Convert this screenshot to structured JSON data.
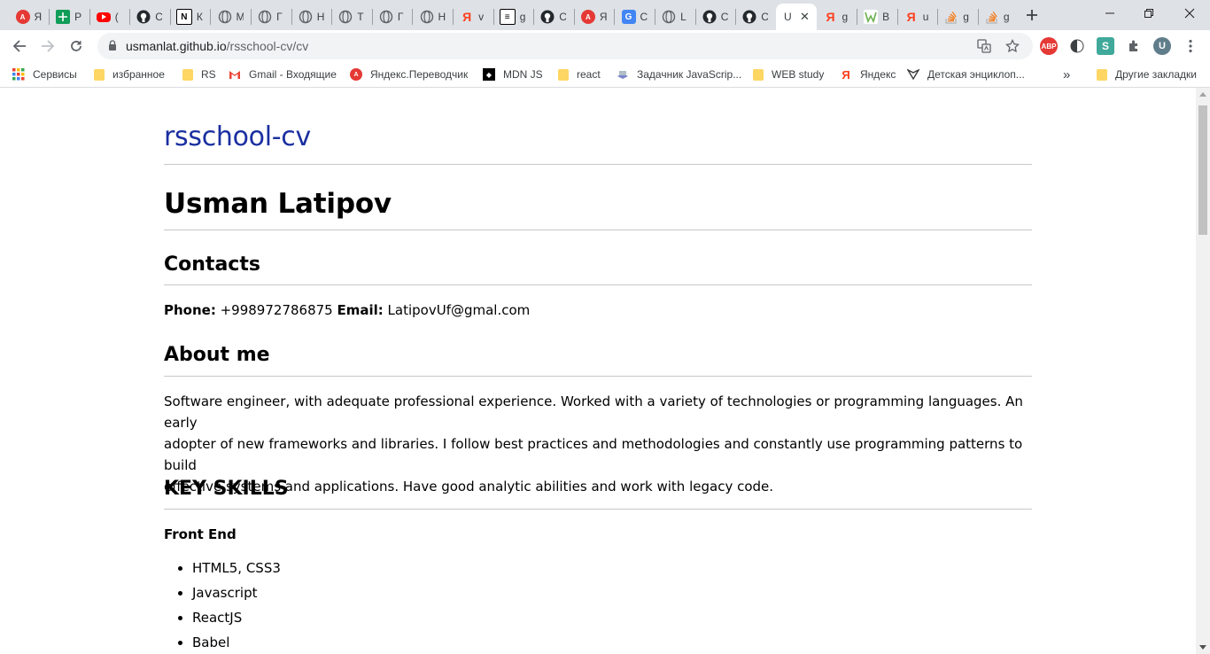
{
  "browser": {
    "tabs": [
      {
        "icon": "abp-icon",
        "title": "Я",
        "color": "#e53935"
      },
      {
        "icon": "sheets-icon",
        "title": "Р",
        "color": "#0f9d58"
      },
      {
        "icon": "youtube-icon",
        "title": "(",
        "color": "#ff0000"
      },
      {
        "icon": "github-icon",
        "title": "С",
        "color": "#24292e"
      },
      {
        "icon": "notion-icon",
        "title": "К",
        "color": "#000000"
      },
      {
        "icon": "globe-icon",
        "title": "М",
        "color": "#5f6368"
      },
      {
        "icon": "globe-icon",
        "title": "Г",
        "color": "#5f6368"
      },
      {
        "icon": "globe-icon",
        "title": "Н",
        "color": "#5f6368"
      },
      {
        "icon": "globe-icon",
        "title": "Т",
        "color": "#5f6368"
      },
      {
        "icon": "globe-icon",
        "title": "Г",
        "color": "#5f6368"
      },
      {
        "icon": "globe-icon",
        "title": "Н",
        "color": "#5f6368"
      },
      {
        "icon": "yandex-icon",
        "title": "v",
        "color": "#fc3f1d"
      },
      {
        "icon": "issue-icon",
        "title": "g",
        "color": "#000000"
      },
      {
        "icon": "github-icon",
        "title": "С",
        "color": "#24292e"
      },
      {
        "icon": "abp-icon",
        "title": "Я",
        "color": "#e53935"
      },
      {
        "icon": "translate-icon",
        "title": "С",
        "color": "#4285f4"
      },
      {
        "icon": "globe-icon",
        "title": "L",
        "color": "#5f6368"
      },
      {
        "icon": "github-icon",
        "title": "С",
        "color": "#24292e"
      },
      {
        "icon": "github-icon",
        "title": "С",
        "color": "#24292e"
      },
      {
        "icon": "",
        "title": "U",
        "color": "#ffffff",
        "active": true
      },
      {
        "icon": "yandex-icon",
        "title": "g",
        "color": "#fc3f1d"
      },
      {
        "icon": "codewars-icon",
        "title": "В",
        "color": "#6ab04c"
      },
      {
        "icon": "yandex-icon",
        "title": "u",
        "color": "#fc3f1d"
      },
      {
        "icon": "stackoverflow-icon",
        "title": "g",
        "color": "#f48024"
      },
      {
        "icon": "stackoverflow-icon",
        "title": "g",
        "color": "#f48024"
      }
    ],
    "url_host": "usmanlat.github.io",
    "url_path": "/rsschool-cv/cv",
    "avatar_letter": "U",
    "abp_label": "ABP",
    "bookmarks": [
      {
        "label": "Сервисы",
        "icon": "apps-icon"
      },
      {
        "label": "избранное",
        "icon": "folder-icon"
      },
      {
        "label": "RS",
        "icon": "folder-icon"
      },
      {
        "label": "Gmail - Входящие",
        "icon": "gmail-icon"
      },
      {
        "label": "Яндекс.Переводчик",
        "icon": "abp-icon"
      },
      {
        "label": "MDN JS",
        "icon": "mdn-icon"
      },
      {
        "label": "react",
        "icon": "folder-icon"
      },
      {
        "label": "Задачник JavaScrip...",
        "icon": "book-icon"
      },
      {
        "label": "WEB study",
        "icon": "folder-icon"
      },
      {
        "label": "Яндекс",
        "icon": "yandex-icon"
      },
      {
        "label": "Детская энциклоп...",
        "icon": "encyclopedia-icon"
      }
    ],
    "other_bookmarks": "Другие закладки",
    "overflow": "»"
  },
  "page": {
    "site_title": "rsschool-cv",
    "name": "Usman Latipov",
    "contacts_heading": "Contacts",
    "phone_label": "Phone:",
    "phone": "+998972786875",
    "email_label": "Email:",
    "email": "LatipovUf@gmal.com",
    "about_heading": "About me",
    "about_line1": "Software engineer, with adequate professional experience. Worked with a variety of technologies or programming languages. An early",
    "about_line2": "adopter of new frameworks and libraries. I follow best practices and methodologies and constantly use programming patterns to build",
    "about_line3": "effective systems and applications. Have good analytic abilities and work with legacy code.",
    "skills_heading": "KEY SKILLS",
    "frontend_heading": "Front End",
    "skills": [
      "HTML5, CSS3",
      "Javascript",
      "ReactJS",
      "Babel"
    ]
  },
  "colors": {
    "tabstrip": "#dee1e6",
    "link_title": "#1a2fa0",
    "folder": "#fdd663"
  }
}
